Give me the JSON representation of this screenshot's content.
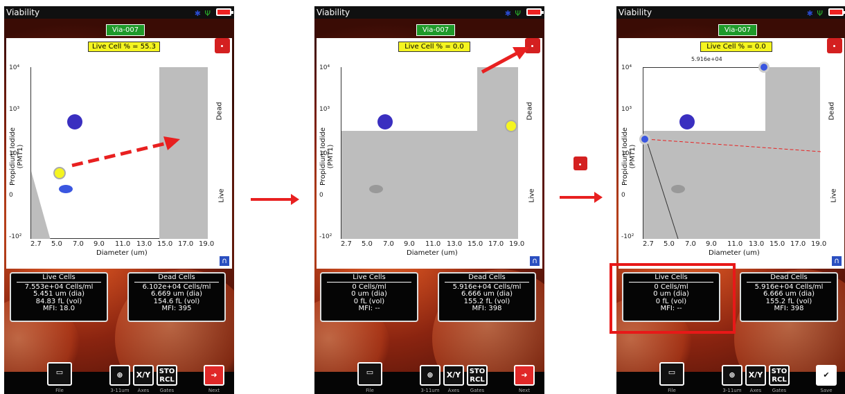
{
  "panels": [
    {
      "title": "Viability",
      "sample_id": "Via-007",
      "live_pct_label": "Live Cell % = 55.3",
      "y_axis_label": "Propidium Iodide (PMT1)",
      "x_axis_label": "Diameter (um)",
      "y_ticks": [
        "10⁴",
        "10³",
        "10²",
        "0",
        "-10²"
      ],
      "x_ticks": [
        "2.7",
        "5.0",
        "7.0",
        "9.0",
        "11.0",
        "13.0",
        "15.0",
        "17.0",
        "19.0"
      ],
      "dead_label": "Dead",
      "live_label": "Live",
      "live": {
        "header": "Live Cells",
        "conc": "7.553e+04 Cells/ml",
        "dia": "5.451 um (dia)",
        "vol": "84.83 fL (vol)",
        "mfi": "MFI:  18.0"
      },
      "dead": {
        "header": "Dead Cells",
        "conc": "6.102e+04 Cells/ml",
        "dia": "6.669 um (dia)",
        "vol": "154.6 fL (vol)",
        "mfi": "MFI:    395"
      },
      "tools": {
        "file": "File",
        "zoom": "3-11um",
        "axes": "Axes",
        "gates": "Gates",
        "next": "Next",
        "xy": "X/Y",
        "sto": "STO",
        "rcl": "RCL"
      }
    },
    {
      "title": "Viability",
      "sample_id": "Via-007",
      "live_pct_label": "Live Cell % = 0.0",
      "y_axis_label": "Propidium Iodide (PMT1)",
      "x_axis_label": "Diameter (um)",
      "y_ticks": [
        "10⁴",
        "10³",
        "10²",
        "0",
        "-10²"
      ],
      "x_ticks": [
        "2.7",
        "5.0",
        "7.0",
        "9.0",
        "11.0",
        "13.0",
        "15.0",
        "17.0",
        "19.0"
      ],
      "dead_label": "Dead",
      "live_label": "Live",
      "live": {
        "header": "Live Cells",
        "conc": "0 Cells/ml",
        "dia": "0 um (dia)",
        "vol": "0 fL (vol)",
        "mfi": "MFI:  --"
      },
      "dead": {
        "header": "Dead Cells",
        "conc": "5.916e+04 Cells/ml",
        "dia": "6.666 um (dia)",
        "vol": "155.2 fL (vol)",
        "mfi": "MFI:    398"
      },
      "tools": {
        "file": "File",
        "zoom": "3-11um",
        "axes": "Axes",
        "gates": "Gates",
        "next": "Next",
        "xy": "X/Y",
        "sto": "STO",
        "rcl": "RCL"
      }
    },
    {
      "title": "Viability",
      "sample_id": "Via-007",
      "live_pct_label": "Live Cell % = 0.0",
      "y_axis_label": "Propidium Iodide (PMT1)",
      "x_axis_label": "Diameter (um)",
      "y_ticks": [
        "10⁴",
        "10³",
        "10²",
        "0",
        "-10²"
      ],
      "x_ticks": [
        "2.7",
        "5.0",
        "7.0",
        "9.0",
        "11.0",
        "13.0",
        "15.0",
        "17.0",
        "19.0"
      ],
      "dead_label": "Dead",
      "live_label": "Live",
      "gate_readout": "5.916e+04",
      "live": {
        "header": "Live Cells",
        "conc": "0 Cells/ml",
        "dia": "0 um (dia)",
        "vol": "0 fL (vol)",
        "mfi": "MFI:  --"
      },
      "dead": {
        "header": "Dead Cells",
        "conc": "5.916e+04 Cells/ml",
        "dia": "6.666 um (dia)",
        "vol": "155.2 fL (vol)",
        "mfi": "MFI:    398"
      },
      "tools": {
        "file": "File",
        "zoom": "3-11um",
        "axes": "Axes",
        "gates": "Gates",
        "save": "Save",
        "xy": "X/Y",
        "sto": "STO",
        "rcl": "RCL"
      }
    }
  ],
  "colors": {
    "accent_red": "#e82020",
    "live_gate": "#f5f520",
    "sample_tag": "#1e9a2a",
    "dead_region": "#bdbdbd"
  }
}
